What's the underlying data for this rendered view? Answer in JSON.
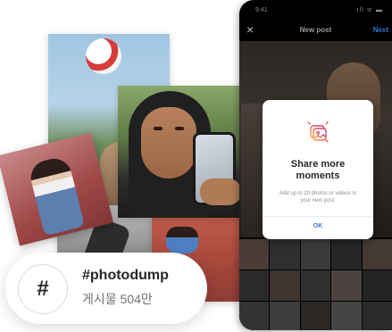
{
  "hashtag": {
    "symbol": "#",
    "name": "#photodump",
    "post_count": "게시물 504만"
  },
  "phone": {
    "status_time": "9:41",
    "status_icons": "ıll ᯤ ▬",
    "close_icon": "×",
    "title": "New post",
    "next_label": "Next"
  },
  "modal": {
    "icon": "photo-stack-icon",
    "title_line1": "Share more",
    "title_line2": "moments",
    "body_line1": "Add up to 20 photos or videos in",
    "body_line2": "your next post.",
    "ok_label": "OK"
  },
  "colors": {
    "accent_blue": "#3d6fd6",
    "icon_gradient_start": "#f7a23b",
    "icon_gradient_end": "#d62976"
  }
}
